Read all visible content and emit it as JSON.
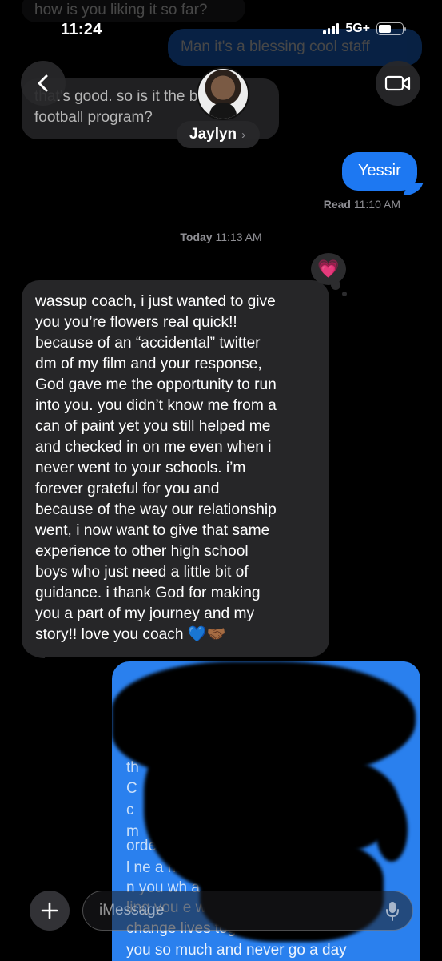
{
  "status_bar": {
    "time": "11:24",
    "network": "5G+"
  },
  "header": {
    "contact_name": "Jaylyn",
    "chevron": "›",
    "back_icon": "chevron-left-icon",
    "video_icon": "video-camera-icon"
  },
  "earlier_messages": [
    {
      "from": "them",
      "text": "how is you liking it so far?"
    },
    {
      "from": "me",
      "text": "Man it's a blessing cool staff"
    },
    {
      "from": "them",
      "text": "that's good. so is it the best"
    },
    {
      "from": "them",
      "text": "football program?"
    }
  ],
  "sent_message": {
    "text": "Yessir"
  },
  "read_receipt": {
    "label": "Read",
    "time": "11:10 AM"
  },
  "timestamp": {
    "day": "Today",
    "time": "11:13 AM"
  },
  "tapback": {
    "emoji": "💗"
  },
  "received_message": {
    "lines": [
      "wassup coach, i just wanted to give",
      "you you’re flowers real quick!!",
      "because of an “accidental” twitter",
      "dm of my film and your response,",
      "God gave me the opportunity to run",
      "into you. you didn’t know me from a",
      "can of paint yet you still helped me",
      "and checked in on me even when i",
      "never went to your schools. i’m",
      "forever grateful for you and",
      "because of the way our relationship",
      "went, i now want to give that same",
      "experience to other high school",
      "boys who just need a little bit of",
      "guidance. i thank God for making",
      "you a part of my journey and my",
      "story!! love you coach 💙🤝🏾"
    ]
  },
  "reply_visible_fragments": [
    "th",
    "C",
    "c",
    "m",
    "orde",
    "l                 ne a              nt. I",
    "n           you wh           a head job",
    "             ling you        e will unite a  f",
    "change lives together. Man I love",
    "you so much and never go a day"
  ],
  "input_bar": {
    "placeholder": "iMessage",
    "plus_icon": "plus-icon",
    "mic_icon": "microphone-icon"
  },
  "colors": {
    "background": "#000000",
    "sent_bubble": "#1d78f2",
    "received_bubble": "#262628",
    "secondary_text": "#8e8e93"
  }
}
